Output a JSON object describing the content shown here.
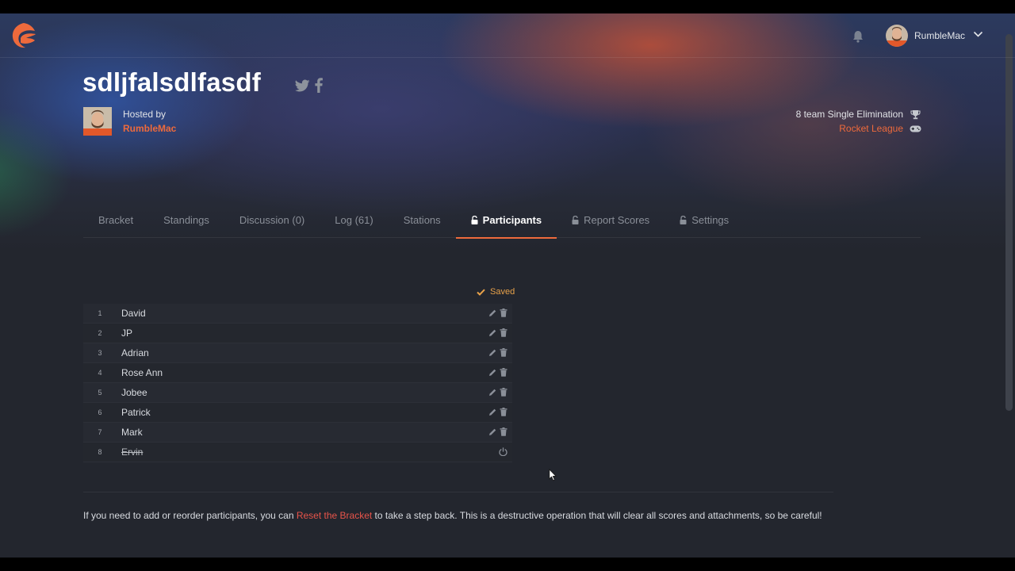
{
  "topbar": {
    "username": "RumbleMac",
    "icons": [
      "logo-icon",
      "bell-icon",
      "chevron-down-icon"
    ]
  },
  "tournament": {
    "title": "sdljfalsdlfasdf",
    "hosted_by_label": "Hosted by",
    "host_name": "RumbleMac",
    "format": "8 team Single Elimination",
    "game": "Rocket League"
  },
  "tabs": [
    {
      "label": "Bracket",
      "locked": false,
      "active": false
    },
    {
      "label": "Standings",
      "locked": false,
      "active": false
    },
    {
      "label": "Discussion (0)",
      "locked": false,
      "active": false
    },
    {
      "label": "Log (61)",
      "locked": false,
      "active": false
    },
    {
      "label": "Stations",
      "locked": false,
      "active": false
    },
    {
      "label": "Participants",
      "locked": true,
      "active": true
    },
    {
      "label": "Report Scores",
      "locked": true,
      "active": false
    },
    {
      "label": "Settings",
      "locked": true,
      "active": false
    }
  ],
  "participants": {
    "saved_label": "Saved",
    "rows": [
      {
        "seed": "1",
        "name": "David"
      },
      {
        "seed": "2",
        "name": "JP"
      },
      {
        "seed": "3",
        "name": "Adrian"
      },
      {
        "seed": "4",
        "name": "Rose Ann"
      },
      {
        "seed": "5",
        "name": "Jobee"
      },
      {
        "seed": "6",
        "name": "Patrick"
      },
      {
        "seed": "7",
        "name": "Mark"
      },
      {
        "seed": "8",
        "name": "Ervin",
        "removed": true
      }
    ]
  },
  "notice": {
    "before": "If you need to add or reorder participants, you can ",
    "link": "Reset the Bracket",
    "after": " to take a step back. This is a destructive operation that will clear all scores and attachments, so be careful!"
  },
  "colors": {
    "accent": "#ee6a3c",
    "saved": "#e8a24a",
    "danger_link": "#e8544a",
    "background": "#23262e"
  }
}
